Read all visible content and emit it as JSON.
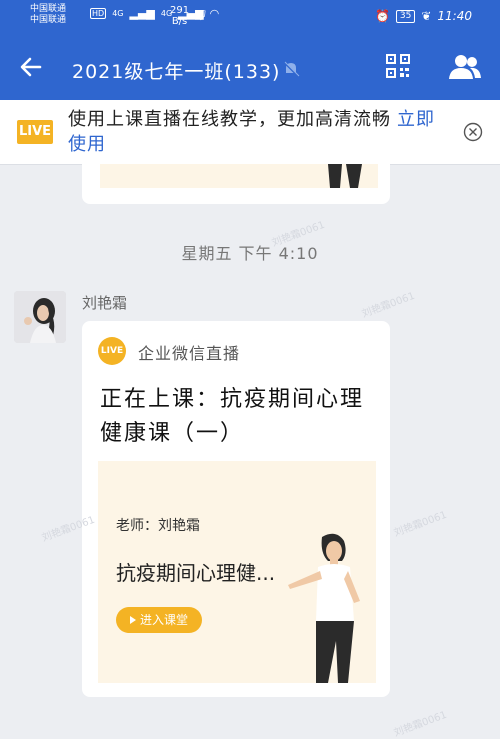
{
  "status_bar": {
    "carrier1": "中国联通",
    "carrier2": "中国联通",
    "hd": "HD",
    "net1": "4G",
    "net2": "4G",
    "speed_value": "291",
    "speed_unit": "B/s",
    "battery": "35",
    "time": "11:40"
  },
  "header": {
    "title": "2021级七年一班(133)"
  },
  "notice": {
    "badge": "LIVE",
    "text": "使用上课直播在线教学，更加高清流畅",
    "link": "立即使用"
  },
  "timestamp": "星期五 下午 4:10",
  "message": {
    "sender": "刘艳霜",
    "card": {
      "badge": "LIVE",
      "source": "企业微信直播",
      "title": "正在上课：抗疫期间心理健康课（一）",
      "teacher": "老师：刘艳霜",
      "course_name": "抗疫期间心理健...",
      "enter_label": "进入课堂"
    }
  },
  "watermark": "刘艳霜0061",
  "colors": {
    "header_blue": "#2f66cf",
    "live_yellow": "#f4b324",
    "banner_bg": "#fdf5e6",
    "chat_bg": "#eceef2"
  },
  "icons": [
    "back-arrow-icon",
    "mute-icon",
    "qr-code-icon",
    "group-members-icon",
    "close-circle-icon",
    "play-icon"
  ]
}
